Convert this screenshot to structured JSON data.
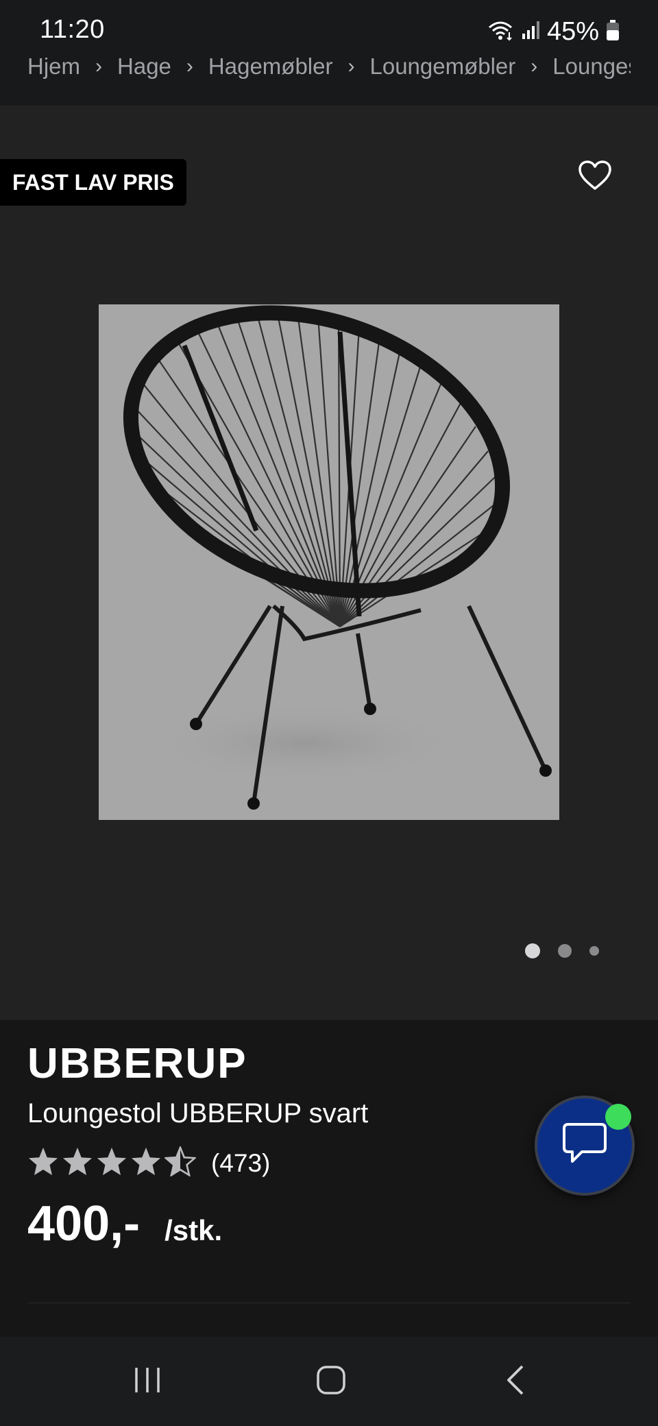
{
  "status_bar": {
    "time": "11:20",
    "battery_percent": "45%",
    "icons": [
      "wifi-icon",
      "signal-icon",
      "battery-icon"
    ]
  },
  "breadcrumb": {
    "items": [
      "Hjem",
      "Hage",
      "Hagemøbler",
      "Loungemøbler",
      "Loungestoler"
    ],
    "separator": "›"
  },
  "gallery": {
    "badge": "FAST LAV PRIS",
    "favorite_icon": "heart-icon",
    "image_count": 3,
    "active_index": 0
  },
  "product": {
    "brand": "UBBERUP",
    "name": "Loungestol UBBERUP svart",
    "rating": 4.5,
    "review_count": "(473)",
    "price": "400,-",
    "unit": "/stk."
  },
  "chat": {
    "icon": "chat-icon",
    "online": true,
    "indicator_color": "#3ddc5b",
    "button_color": "#0b2f87"
  },
  "nav_bar": {
    "buttons": [
      "recent-apps-icon",
      "home-icon",
      "back-icon"
    ]
  }
}
